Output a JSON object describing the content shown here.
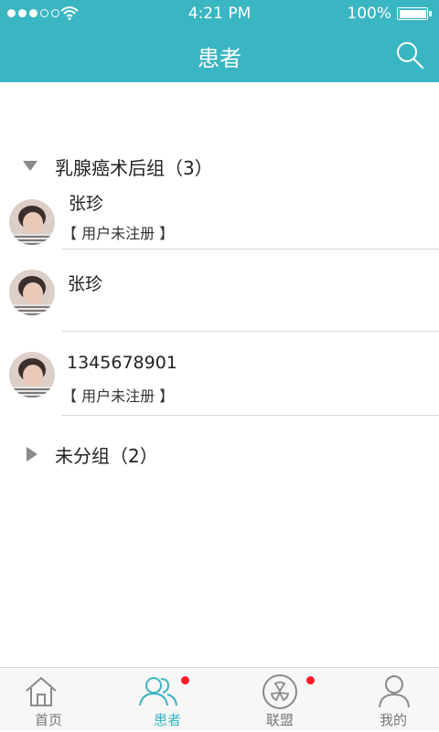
{
  "status_bar": {
    "time": "4:21 PM",
    "battery": "100%"
  },
  "nav": {
    "title": "患者"
  },
  "groups": [
    {
      "title": "乳腺癌术后组（3）",
      "expanded": true,
      "patients": [
        {
          "name": "张珍",
          "status": "【 用户未注册 】"
        },
        {
          "name": "张珍",
          "status": ""
        },
        {
          "name": "1345678901",
          "status": "【 用户未注册 】"
        }
      ]
    },
    {
      "title": "未分组（2）",
      "expanded": false
    }
  ],
  "tabs": [
    {
      "label": "首页",
      "icon": "home-icon",
      "active": false,
      "badge": false
    },
    {
      "label": "患者",
      "icon": "patients-icon",
      "active": true,
      "badge": true
    },
    {
      "label": "联盟",
      "icon": "alliance-icon",
      "active": false,
      "badge": true
    },
    {
      "label": "我的",
      "icon": "profile-icon",
      "active": false,
      "badge": false
    }
  ],
  "colors": {
    "accent": "#3ab5c2",
    "badge": "#ff1a2a"
  }
}
